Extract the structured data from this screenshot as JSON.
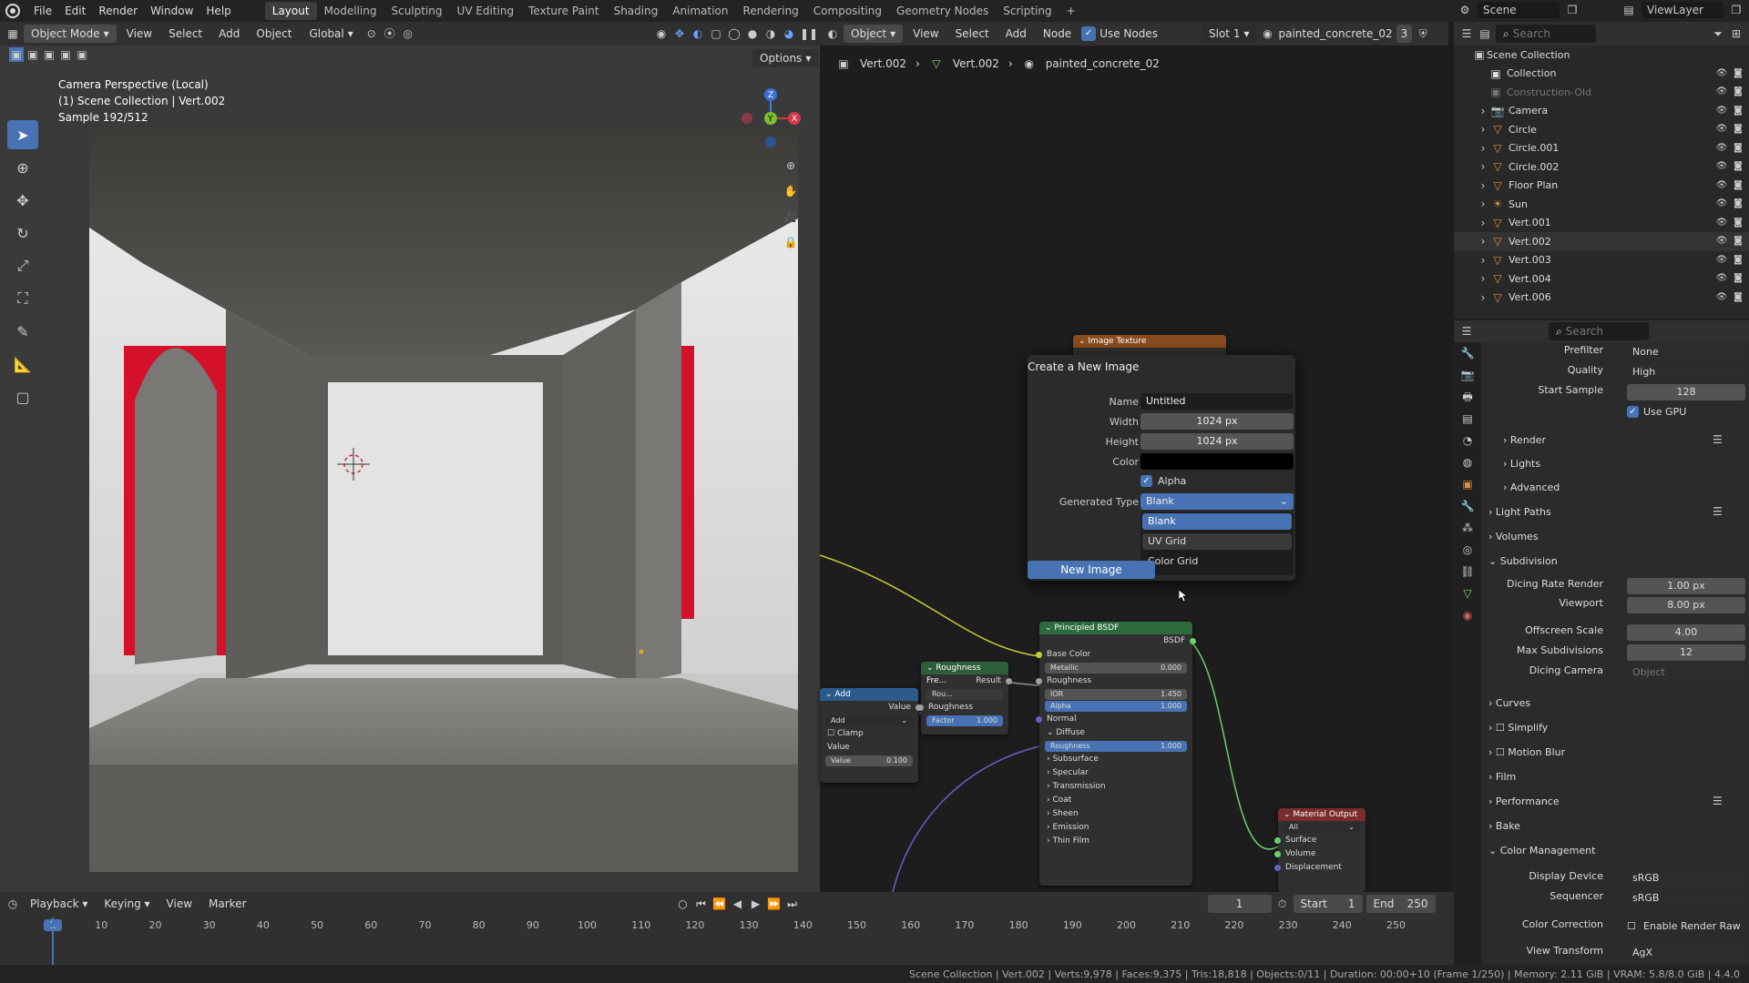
{
  "menus": [
    "File",
    "Edit",
    "Render",
    "Window",
    "Help"
  ],
  "workspaces": [
    "Layout",
    "Modelling",
    "Sculpting",
    "UV Editing",
    "Texture Paint",
    "Shading",
    "Animation",
    "Rendering",
    "Compositing",
    "Geometry Nodes",
    "Scripting"
  ],
  "active_workspace": "Layout",
  "scene_name": "Scene",
  "view_layer": "ViewLayer",
  "viewport": {
    "mode": "Object Mode",
    "menus": [
      "View",
      "Select",
      "Add",
      "Object"
    ],
    "orientation": "Global",
    "options": "Options",
    "overlay_lines": [
      "Camera Perspective (Local)",
      "(1) Scene Collection | Vert.002",
      "Sample 192/512"
    ]
  },
  "node_editor": {
    "object_mode": "Object",
    "menus": [
      "View",
      "Select",
      "Add",
      "Node"
    ],
    "use_nodes": "Use Nodes",
    "slot": "Slot 1",
    "material": "painted_concrete_02",
    "user_count": "3",
    "breadcrumb": [
      "Vert.002",
      "Vert.002",
      "painted_concrete_02"
    ],
    "image_texture_title": "Image Texture",
    "principled": {
      "title": "Principled BSDF",
      "output": "BSDF",
      "rows": [
        {
          "label": "Base Color"
        },
        {
          "label": "Metallic",
          "value": "0.000"
        },
        {
          "label": "Roughness"
        },
        {
          "label": "IOR",
          "value": "1.450"
        },
        {
          "label": "Alpha",
          "value": "1.000"
        },
        {
          "label": "Normal"
        },
        {
          "label": "Diffuse"
        },
        {
          "label": "Roughness",
          "value": "1.000"
        },
        {
          "label": "Subsurface"
        },
        {
          "label": "Specular"
        },
        {
          "label": "Transmission"
        },
        {
          "label": "Coat"
        },
        {
          "label": "Sheen"
        },
        {
          "label": "Emission"
        },
        {
          "label": "Thin Film"
        }
      ]
    },
    "roughness_node": {
      "title": "Roughness Fre...",
      "result": "Result",
      "sub": "Rou...",
      "rows": [
        "Roughness"
      ],
      "factor_label": "Factor",
      "factor_value": "1.000"
    },
    "add_node": {
      "title": "Add",
      "value_label": "Value",
      "op": "Add",
      "clamp": "Clamp",
      "value2": "Value",
      "value3_label": "Value",
      "value3": "0.100"
    },
    "material_output": {
      "title": "Material Output",
      "target": "All",
      "rows": [
        "Surface",
        "Volume",
        "Displacement"
      ]
    }
  },
  "popup": {
    "title": "Create a New Image",
    "name_label": "Name",
    "name_value": "Untitled",
    "width_label": "Width",
    "width_value": "1024 px",
    "height_label": "Height",
    "height_value": "1024 px",
    "color_label": "Color",
    "alpha_label": "Alpha",
    "gen_type_label": "Generated Type",
    "gen_type_value": "Blank",
    "options": [
      "Blank",
      "UV Grid",
      "Color Grid"
    ],
    "new_image": "New Image"
  },
  "outliner": {
    "search_placeholder": "Search",
    "root": "Scene Collection",
    "items": [
      {
        "name": "Collection",
        "type": "collection"
      },
      {
        "name": "Construction-Old",
        "type": "collection-dim"
      },
      {
        "name": "Camera",
        "type": "camera"
      },
      {
        "name": "Circle",
        "type": "mesh"
      },
      {
        "name": "Circle.001",
        "type": "mesh"
      },
      {
        "name": "Circle.002",
        "type": "mesh"
      },
      {
        "name": "Floor Plan",
        "type": "mesh"
      },
      {
        "name": "Sun",
        "type": "light"
      },
      {
        "name": "Vert.001",
        "type": "mesh"
      },
      {
        "name": "Vert.002",
        "type": "mesh"
      },
      {
        "name": "Vert.003",
        "type": "mesh"
      },
      {
        "name": "Vert.004",
        "type": "mesh"
      },
      {
        "name": "Vert.006",
        "type": "mesh"
      }
    ]
  },
  "properties": {
    "search_placeholder": "Search",
    "prefilter_label": "Prefilter",
    "prefilter": "None",
    "quality_label": "Quality",
    "quality": "High",
    "start_sample_label": "Start Sample",
    "start_sample": "128",
    "use_gpu": "Use GPU",
    "sub_sections": [
      "Render",
      "Lights",
      "Advanced"
    ],
    "sections": [
      "Light Paths",
      "Volumes",
      "Subdivision"
    ],
    "dicing_rate_label": "Dicing Rate Render",
    "dicing_rate": "1.00 px",
    "viewport_label": "Viewport",
    "viewport": "8.00 px",
    "offscreen_label": "Offscreen Scale",
    "offscreen": "4.00",
    "max_sub_label": "Max Subdivisions",
    "max_sub": "12",
    "dicing_cam_label": "Dicing Camera",
    "dicing_cam": "Object",
    "sections2": [
      "Curves",
      "Simplify",
      "Motion Blur",
      "Film",
      "Performance",
      "Bake",
      "Color Management"
    ],
    "display_device_label": "Display Device",
    "display_device": "sRGB",
    "sequencer_label": "Sequencer",
    "sequencer": "sRGB",
    "color_correction_label": "Color Correction",
    "color_correction": "Enable Render Raw",
    "view_transform_label": "View Transform",
    "view_transform": "AgX"
  },
  "timeline": {
    "menus": [
      "Playback",
      "Keying",
      "View",
      "Marker"
    ],
    "current_frame": "1",
    "start_label": "Start",
    "start": "1",
    "end_label": "End",
    "end": "250",
    "ticks": [
      "1",
      "10",
      "20",
      "30",
      "40",
      "50",
      "60",
      "70",
      "80",
      "90",
      "100",
      "110",
      "120",
      "130",
      "140",
      "150",
      "160",
      "170",
      "180",
      "190",
      "200",
      "210",
      "220",
      "230",
      "240",
      "250"
    ]
  },
  "status_bar": "Scene Collection | Vert.002 | Verts:9,978 | Faces:9,375 | Tris:18,818 | Objects:0/11 | Duration: 00:00+10 (Frame 1/250) | Memory: 2.11 GiB | VRAM: 5.8/8.0 GiB | 4.4.0",
  "colors": {
    "accent": "#4772b3",
    "header_green": "#2d6b3f",
    "image_tex_orange": "#8a4c1f",
    "red_frame": "#d4102a"
  }
}
